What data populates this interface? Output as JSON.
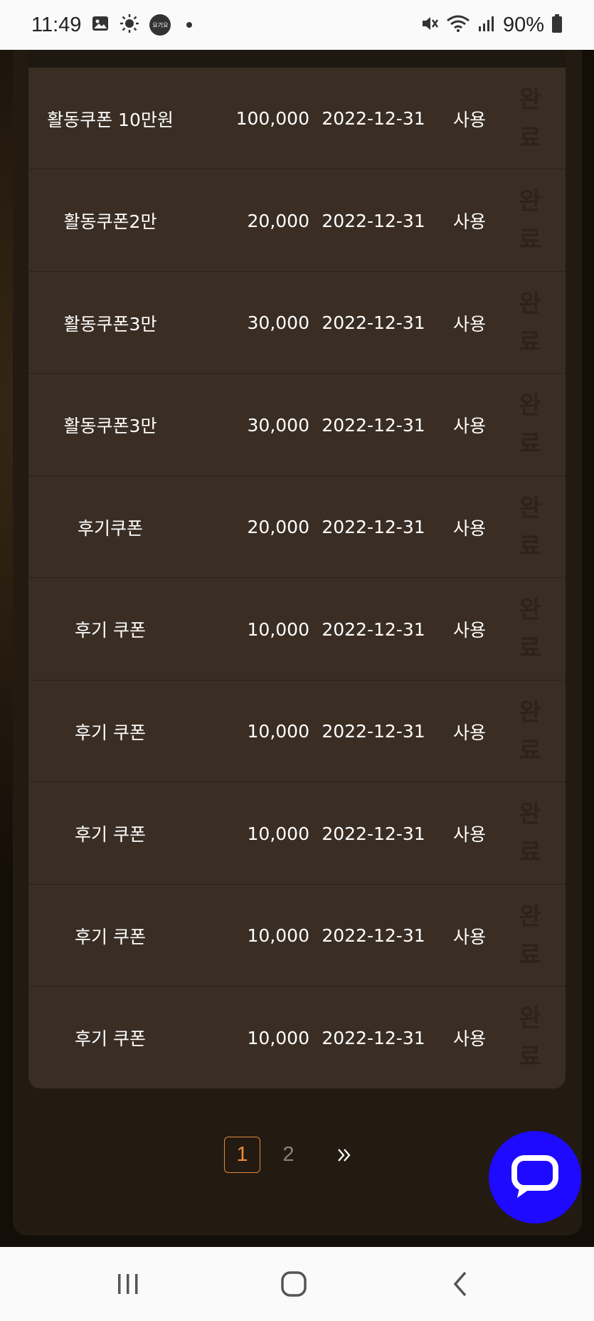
{
  "status_bar": {
    "time": "11:49",
    "badge_text": "요기요",
    "battery": "90%"
  },
  "coupons": [
    {
      "name": "활동쿠폰 10만원",
      "amount": "100,000",
      "expiry": "2022-12-31",
      "status": "사용",
      "done": [
        "완",
        "료"
      ]
    },
    {
      "name": "활동쿠폰2만",
      "amount": "20,000",
      "expiry": "2022-12-31",
      "status": "사용",
      "done": [
        "완",
        "료"
      ]
    },
    {
      "name": "활동쿠폰3만",
      "amount": "30,000",
      "expiry": "2022-12-31",
      "status": "사용",
      "done": [
        "완",
        "료"
      ]
    },
    {
      "name": "활동쿠폰3만",
      "amount": "30,000",
      "expiry": "2022-12-31",
      "status": "사용",
      "done": [
        "완",
        "료"
      ]
    },
    {
      "name": "후기쿠폰",
      "amount": "20,000",
      "expiry": "2022-12-31",
      "status": "사용",
      "done": [
        "완",
        "료"
      ]
    },
    {
      "name": "후기 쿠폰",
      "amount": "10,000",
      "expiry": "2022-12-31",
      "status": "사용",
      "done": [
        "완",
        "료"
      ]
    },
    {
      "name": "후기 쿠폰",
      "amount": "10,000",
      "expiry": "2022-12-31",
      "status": "사용",
      "done": [
        "완",
        "료"
      ]
    },
    {
      "name": "후기 쿠폰",
      "amount": "10,000",
      "expiry": "2022-12-31",
      "status": "사용",
      "done": [
        "완",
        "료"
      ]
    },
    {
      "name": "후기 쿠폰",
      "amount": "10,000",
      "expiry": "2022-12-31",
      "status": "사용",
      "done": [
        "완",
        "료"
      ]
    },
    {
      "name": "후기 쿠폰",
      "amount": "10,000",
      "expiry": "2022-12-31",
      "status": "사용",
      "done": [
        "완",
        "료"
      ]
    }
  ],
  "pagination": {
    "pages": [
      "1",
      "2"
    ],
    "current": "1",
    "next_label": "»"
  },
  "colors": {
    "accent_page": "#f08a3a",
    "chat_fab": "#1e0aff",
    "card_bg": "#3a2e24"
  },
  "icons": {
    "chat": "chat-bubble-icon",
    "nav_recent": "recent-apps-icon",
    "nav_home": "home-icon",
    "nav_back": "back-icon"
  }
}
